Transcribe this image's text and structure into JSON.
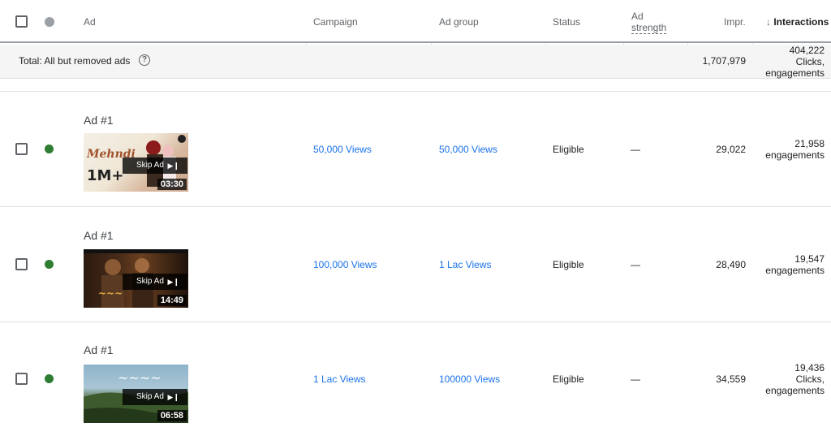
{
  "header": {
    "ad": "Ad",
    "campaign": "Campaign",
    "ad_group": "Ad group",
    "status": "Status",
    "ad_strength_line1": "Ad",
    "ad_strength_line2": "strength",
    "impr": "Impr.",
    "sort_arrow": "↓",
    "interactions": "Interactions"
  },
  "total": {
    "label": "Total: All but removed ads",
    "help_icon": "?",
    "impr": "1,707,979",
    "interactions_value": "404,222",
    "interactions_line2": "Clicks,",
    "interactions_line3": "engagements"
  },
  "rows": [
    {
      "title": "Ad #1",
      "skip_label": "Skip Ad",
      "skip_glyph": "▶❙",
      "duration": "03:30",
      "campaign": "50,000 Views",
      "ad_group": "50,000 Views",
      "status": "Eligible",
      "ad_strength": "—",
      "impr": "29,022",
      "interactions_value": "21,958",
      "interactions_line2": "engagements"
    },
    {
      "title": "Ad #1",
      "skip_label": "Skip Ad",
      "skip_glyph": "▶❙",
      "duration": "14:49",
      "campaign": "100,000 Views",
      "ad_group": "1 Lac Views",
      "status": "Eligible",
      "ad_strength": "—",
      "impr": "28,490",
      "interactions_value": "19,547",
      "interactions_line2": "engagements"
    },
    {
      "title": "Ad #1",
      "skip_label": "Skip Ad",
      "skip_glyph": "▶❙",
      "duration": "06:58",
      "campaign": "1 Lac Views",
      "ad_group": "100000 Views",
      "status": "Eligible",
      "ad_strength": "—",
      "impr": "34,559",
      "interactions_value": "19,436",
      "interactions_line2": "Clicks,",
      "interactions_line3": "engagements"
    }
  ],
  "colors": {
    "link": "#1a73e8",
    "status_dot_enabled": "#2e7d32",
    "status_dot_header": "#9aa0a6"
  }
}
